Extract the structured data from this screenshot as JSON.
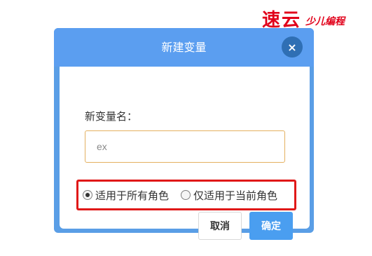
{
  "watermark": {
    "big": "速云",
    "small": "少儿编程"
  },
  "dialog": {
    "title": "新建变量",
    "close_icon": "×",
    "field_label": "新变量名：",
    "input": {
      "value": "ex",
      "placeholder": ""
    },
    "options": [
      {
        "label": "适用于所有角色",
        "checked": true
      },
      {
        "label": "仅适用于当前角色",
        "checked": false
      }
    ],
    "cancel_label": "取消",
    "confirm_label": "确定"
  },
  "colors": {
    "header": "#5b9ef0",
    "close_button": "#2f6fb4",
    "input_border": "#e4b060",
    "highlight_box": "#e01818",
    "confirm_button": "#4a9ef0"
  }
}
